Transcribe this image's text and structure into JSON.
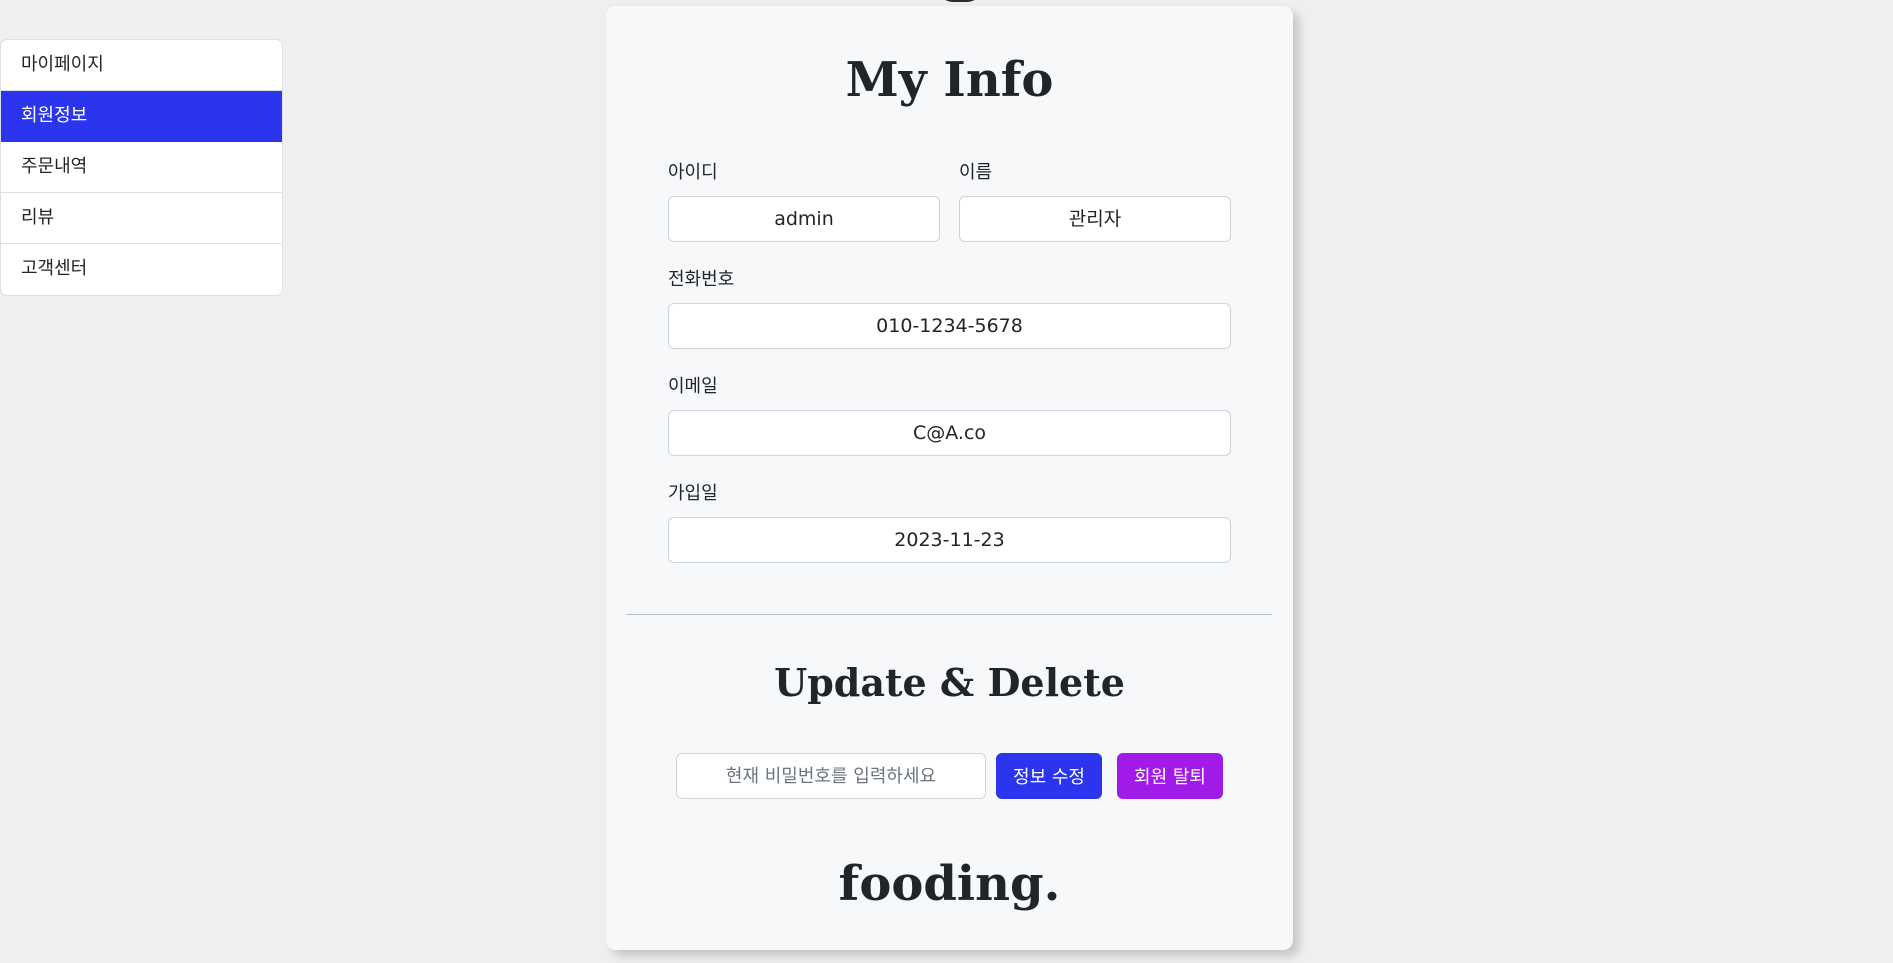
{
  "sidebar": {
    "items": [
      {
        "label": "마이페이지",
        "active": false
      },
      {
        "label": "회원정보",
        "active": true
      },
      {
        "label": "주문내역",
        "active": false
      },
      {
        "label": "리뷰",
        "active": false
      },
      {
        "label": "고객센터",
        "active": false
      }
    ]
  },
  "info": {
    "title": "My Info",
    "id_label": "아이디",
    "id_value": "admin",
    "name_label": "이름",
    "name_value": "관리자",
    "phone_label": "전화번호",
    "phone_value": "010-1234-5678",
    "email_label": "이메일",
    "email_value": "C@A.co",
    "joined_label": "가입일",
    "joined_value": "2023-11-23"
  },
  "account": {
    "title": "Update & Delete",
    "password_placeholder": "현재 비밀번호를 입력하세요",
    "update_label": "정보 수정",
    "delete_label": "회원 탈퇴"
  },
  "footer": {
    "logo": "fooding."
  },
  "colors": {
    "primary": "#2b35ee",
    "danger": "#a01be8",
    "background": "#efefef",
    "card": "#f7f8fa"
  }
}
